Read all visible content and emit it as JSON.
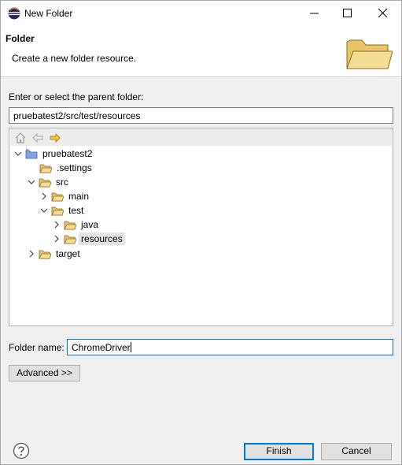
{
  "window": {
    "title": "New Folder"
  },
  "banner": {
    "title": "Folder",
    "description": "Create a new folder resource.",
    "icon": "folder-icon"
  },
  "parent": {
    "label": "Enter or select the parent folder:",
    "value": "pruebatest2/src/test/resources"
  },
  "tree": {
    "toolbar": [
      "home-icon",
      "back-icon",
      "forward-icon"
    ],
    "items": [
      {
        "label": "pruebatest2",
        "expanded": true
      },
      {
        "label": ".settings"
      },
      {
        "label": "src",
        "expanded": true
      },
      {
        "label": "main",
        "expanded": false
      },
      {
        "label": "test",
        "expanded": true
      },
      {
        "label": "java",
        "expanded": false
      },
      {
        "label": "resources",
        "expanded": false,
        "selected": true
      },
      {
        "label": "target",
        "expanded": false
      }
    ]
  },
  "folder_name": {
    "label": "Folder name:",
    "value": "ChromeDriver"
  },
  "buttons": {
    "advanced": "Advanced >>",
    "finish": "Finish",
    "cancel": "Cancel"
  }
}
